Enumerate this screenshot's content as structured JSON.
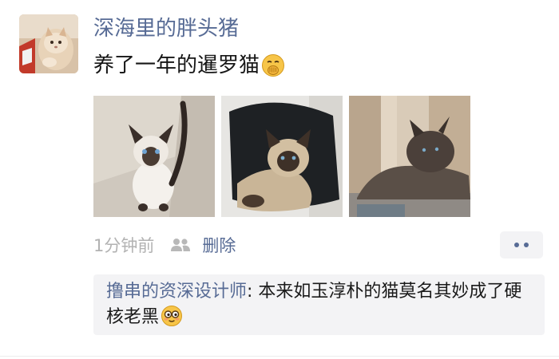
{
  "post": {
    "nickname": "深海里的胖头猪",
    "content_text": "养了一年的暹罗猫",
    "content_emoji": "facepalm-cover-mouth-emoji",
    "photos": [
      {
        "subject": "siamese-kitten-photo"
      },
      {
        "subject": "siamese-cat-on-black-chair-photo"
      },
      {
        "subject": "dark-siamese-cat-on-sill-photo"
      }
    ],
    "time": "1分钟前",
    "delete_label": "删除",
    "more_icon": "more-dots-icon"
  },
  "comments": [
    {
      "author": "撸串的资深设计师",
      "separator": ": ",
      "text": "本来如玉淳朴的猫莫名其妙成了硬核老黑",
      "emoji": "shy-glasses-emoji"
    }
  ],
  "colors": {
    "link": "#576b95",
    "time": "#b2b2b2",
    "comment_bg": "#f3f3f5"
  }
}
